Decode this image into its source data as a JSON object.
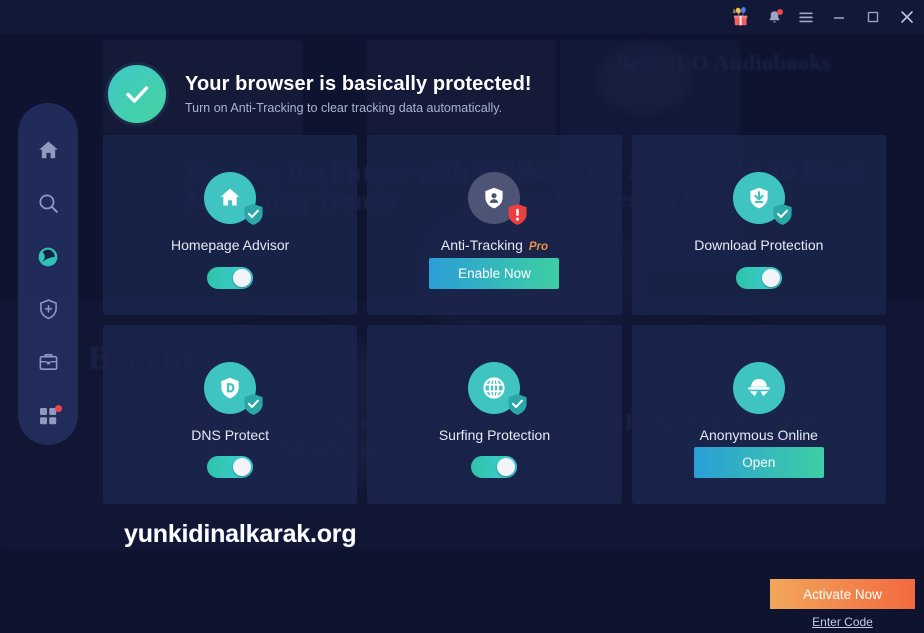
{
  "window": {
    "titlebar_buttons": [
      {
        "name": "gift-icon",
        "label": "Gift"
      },
      {
        "name": "notification-bell-icon",
        "label": "Notifications"
      },
      {
        "name": "menu-icon",
        "label": "Menu"
      }
    ],
    "controls": [
      {
        "name": "minimize-button",
        "label": "Minimize"
      },
      {
        "name": "maximize-button",
        "label": "Maximize"
      },
      {
        "name": "close-button",
        "label": "Close"
      }
    ]
  },
  "sidebar": {
    "items": [
      {
        "name": "sidebar-item-home",
        "icon": "home-icon",
        "label": "Home",
        "active": false,
        "badge": false
      },
      {
        "name": "sidebar-item-search",
        "icon": "search-icon",
        "label": "Search",
        "active": false,
        "badge": false
      },
      {
        "name": "sidebar-item-browser",
        "icon": "globe-icon",
        "label": "Browser",
        "active": true,
        "badge": false
      },
      {
        "name": "sidebar-item-protection",
        "icon": "shield-plus-icon",
        "label": "Protection",
        "active": false,
        "badge": false
      },
      {
        "name": "sidebar-item-toolbox",
        "icon": "briefcase-icon",
        "label": "Toolbox",
        "active": false,
        "badge": false
      },
      {
        "name": "sidebar-item-apps",
        "icon": "grid-icon",
        "label": "Apps",
        "active": false,
        "badge": true
      }
    ]
  },
  "status": {
    "icon": "check-circle-icon",
    "title": "Your browser is basically protected!",
    "subtitle": "Turn on Anti-Tracking to clear tracking data automatically."
  },
  "cards": [
    {
      "name": "card-homepage-advisor",
      "title": "Homepage Advisor",
      "icon": "home-shield-icon",
      "icon_style": "teal",
      "badge": "check",
      "action": {
        "type": "toggle",
        "state": "on"
      },
      "pro": ""
    },
    {
      "name": "card-anti-tracking",
      "title": "Anti-Tracking",
      "icon": "shield-user-icon",
      "icon_style": "gray",
      "badge": "warning",
      "action": {
        "type": "button",
        "label": "Enable Now"
      },
      "pro": "Pro"
    },
    {
      "name": "card-download-protection",
      "title": "Download Protection",
      "icon": "download-shield-icon",
      "icon_style": "teal",
      "badge": "check",
      "action": {
        "type": "toggle",
        "state": "on"
      },
      "pro": ""
    },
    {
      "name": "card-dns-protect",
      "title": "DNS Protect",
      "icon": "dns-shield-icon",
      "icon_style": "teal",
      "badge": "check",
      "action": {
        "type": "toggle",
        "state": "on"
      },
      "pro": ""
    },
    {
      "name": "card-surfing-protection",
      "title": "Surfing Protection",
      "icon": "globe-shield-icon",
      "icon_style": "teal",
      "badge": "check",
      "action": {
        "type": "toggle",
        "state": "on"
      },
      "pro": ""
    },
    {
      "name": "card-anonymous-online",
      "title": "Anonymous Online",
      "icon": "incognito-icon",
      "icon_style": "teal",
      "badge": "none",
      "action": {
        "type": "button",
        "label": "Open"
      },
      "pro": ""
    }
  ],
  "watermark": {
    "text": "yunkidinalkarak.org"
  },
  "activation": {
    "activate_label": "Activate Now",
    "enter_code_label": "Enter Code"
  },
  "background_text": [
    "Shaping the Future with Video",
    "Marketing Trends",
    "7 Best SEO Audiobooks To Boost",
    "your business in Google",
    "Benefits",
    "7 Engaging Video Content Types",
    "Every Marketer Should Know",
    "5 Tips To Help You Avoid Online",
    "Scams",
    "Best SEO Audiobooks"
  ],
  "colors": {
    "accent_teal": "#3fc4c1",
    "accent_green": "#3ecfa4",
    "accent_blue": "#2b9ed6",
    "pro_orange": "#eb9540",
    "activate_orange_start": "#f2a75c",
    "activate_orange_end": "#f2693f",
    "badge_red": "#f0434a",
    "window_bg": "#0e1430",
    "card_bg": "#1c264e",
    "sidebar_bg": "#283469"
  }
}
